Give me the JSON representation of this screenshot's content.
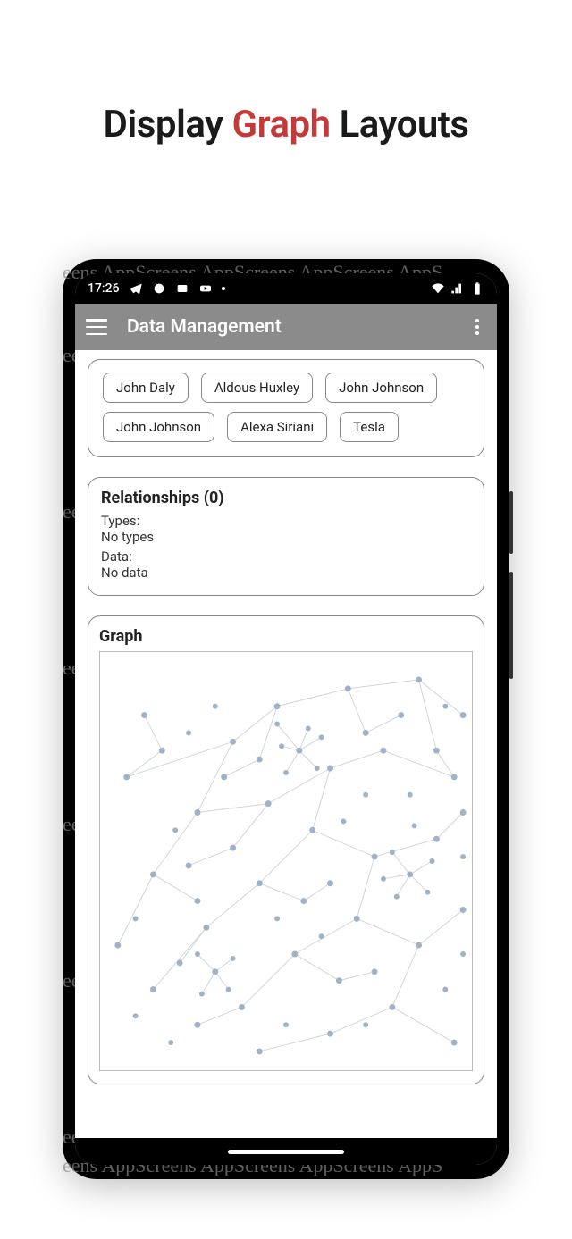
{
  "headline": {
    "part1": "Display ",
    "accent": "Graph",
    "part2": " Layouts"
  },
  "watermark_text": "eens   AppScreens   AppScreens   AppScreens   AppS",
  "status": {
    "time": "17:26"
  },
  "app_bar": {
    "title": "Data Management"
  },
  "chips": [
    {
      "label": "John Daly"
    },
    {
      "label": "Aldous Huxley"
    },
    {
      "label": "John Johnson"
    },
    {
      "label": "John Johnson"
    },
    {
      "label": "Alexa Siriani"
    },
    {
      "label": "Tesla"
    }
  ],
  "relationships": {
    "title": "Relationships (0)",
    "types_label": "Types:",
    "types_value": "No types",
    "data_label": "Data:",
    "data_value": "No data"
  },
  "graph": {
    "title": "Graph"
  },
  "colors": {
    "accent": "#c43a3a",
    "appbar": "#8b8b8b",
    "node": "#9fb3c8",
    "edge": "#cfd6dc"
  }
}
